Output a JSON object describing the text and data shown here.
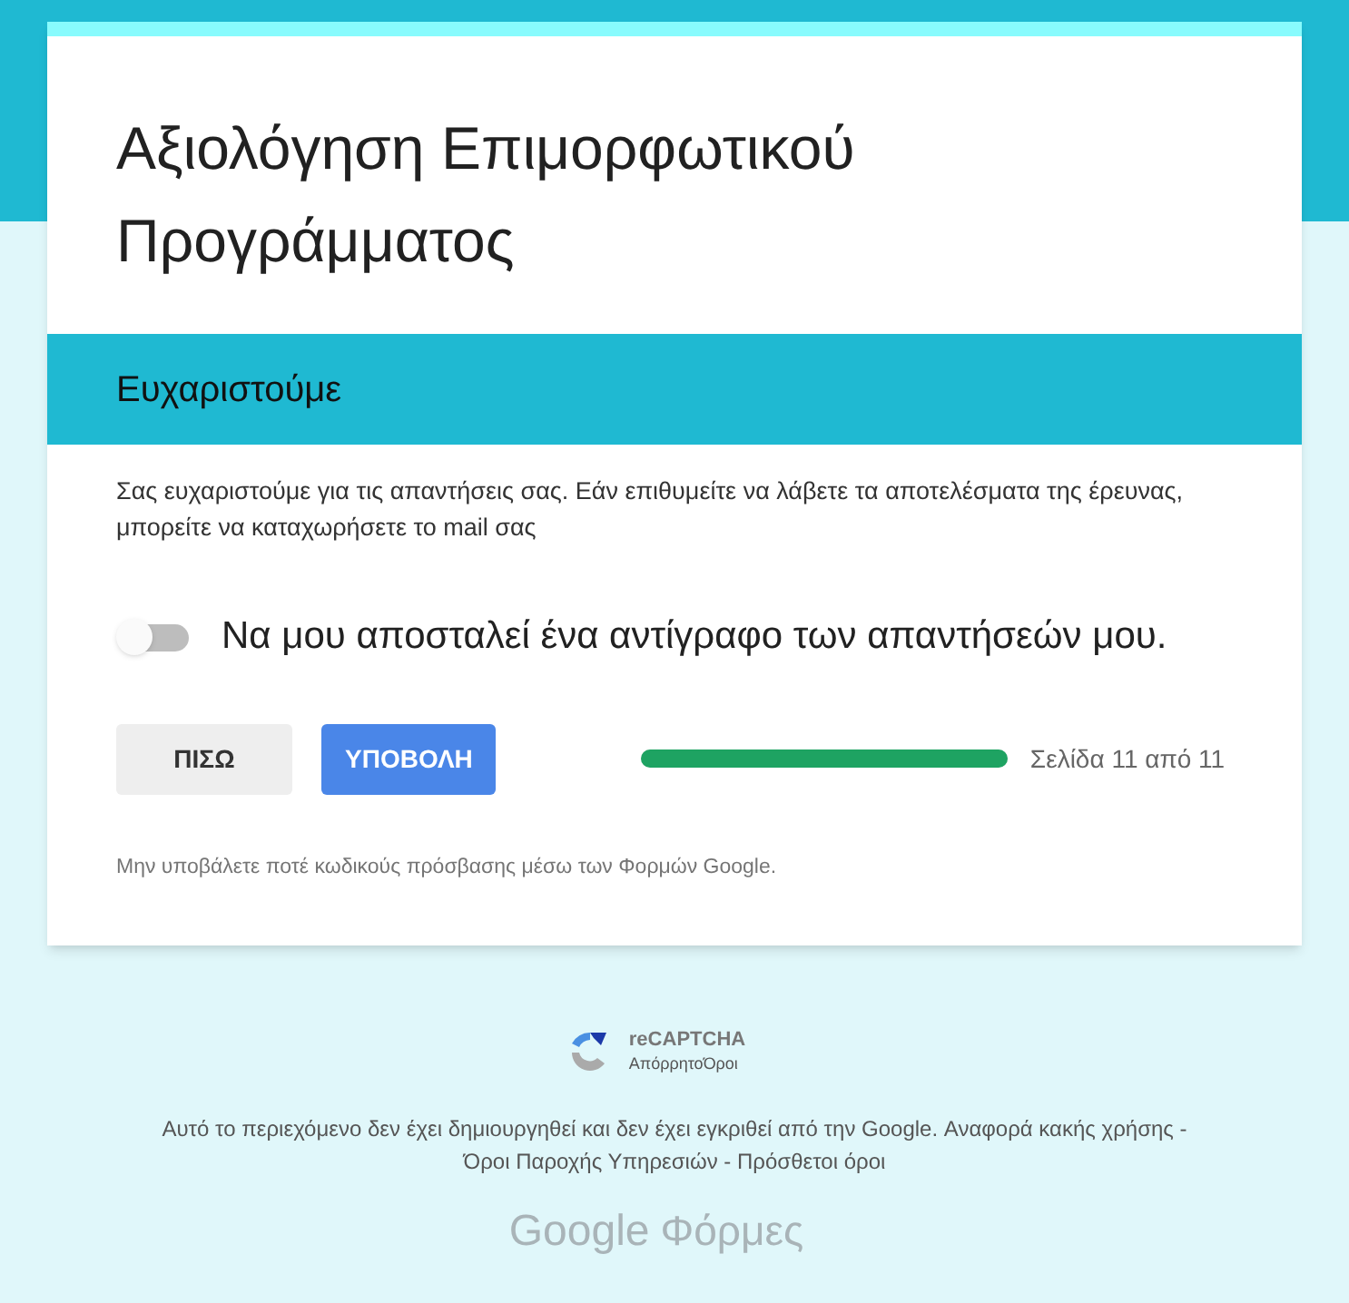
{
  "form": {
    "title": "Αξιολόγηση Επιμορφωτικού Προγράμματος"
  },
  "section": {
    "title": "Ευχαριστούμε",
    "description": "Σας ευχαριστούμε για τις απαντήσεις σας. Εάν επιθυμείτε να λάβετε τα αποτελέσματα της έρευνας, μπορείτε να καταχωρήσετε το mail σας"
  },
  "copy_toggle": {
    "label": "Να μου αποσταλεί ένα αντίγραφο των απαντήσεών μου.",
    "on": false
  },
  "buttons": [
    {
      "label": "ΠΙΣΩ",
      "kind": "secondary"
    },
    {
      "label": "ΥΠΟΒΟΛΗ",
      "kind": "primary"
    }
  ],
  "progress": {
    "level": 1,
    "reading": "Σελίδα 11 από 11"
  },
  "password_warning": "Μην υποβάλετε ποτέ κωδικούς πρόσβασης μέσω των Φορμών Google.",
  "recaptcha": {
    "name": "reCAPTCHA",
    "links": [
      "Απόρρητο",
      "Όροι"
    ]
  },
  "footer": {
    "disclaimer": "Αυτό το περιεχόμενο δεν έχει δημιουργηθεί και δεν έχει εγκριθεί από την Google.",
    "links": [
      "Αναφορά κακής χρήσης",
      "Όροι Παροχής Υπηρεσιών",
      "Πρόσθετοι όροι"
    ],
    "separator": "-"
  },
  "logo": {
    "brand": "Google",
    "product": "Φόρμες"
  }
}
